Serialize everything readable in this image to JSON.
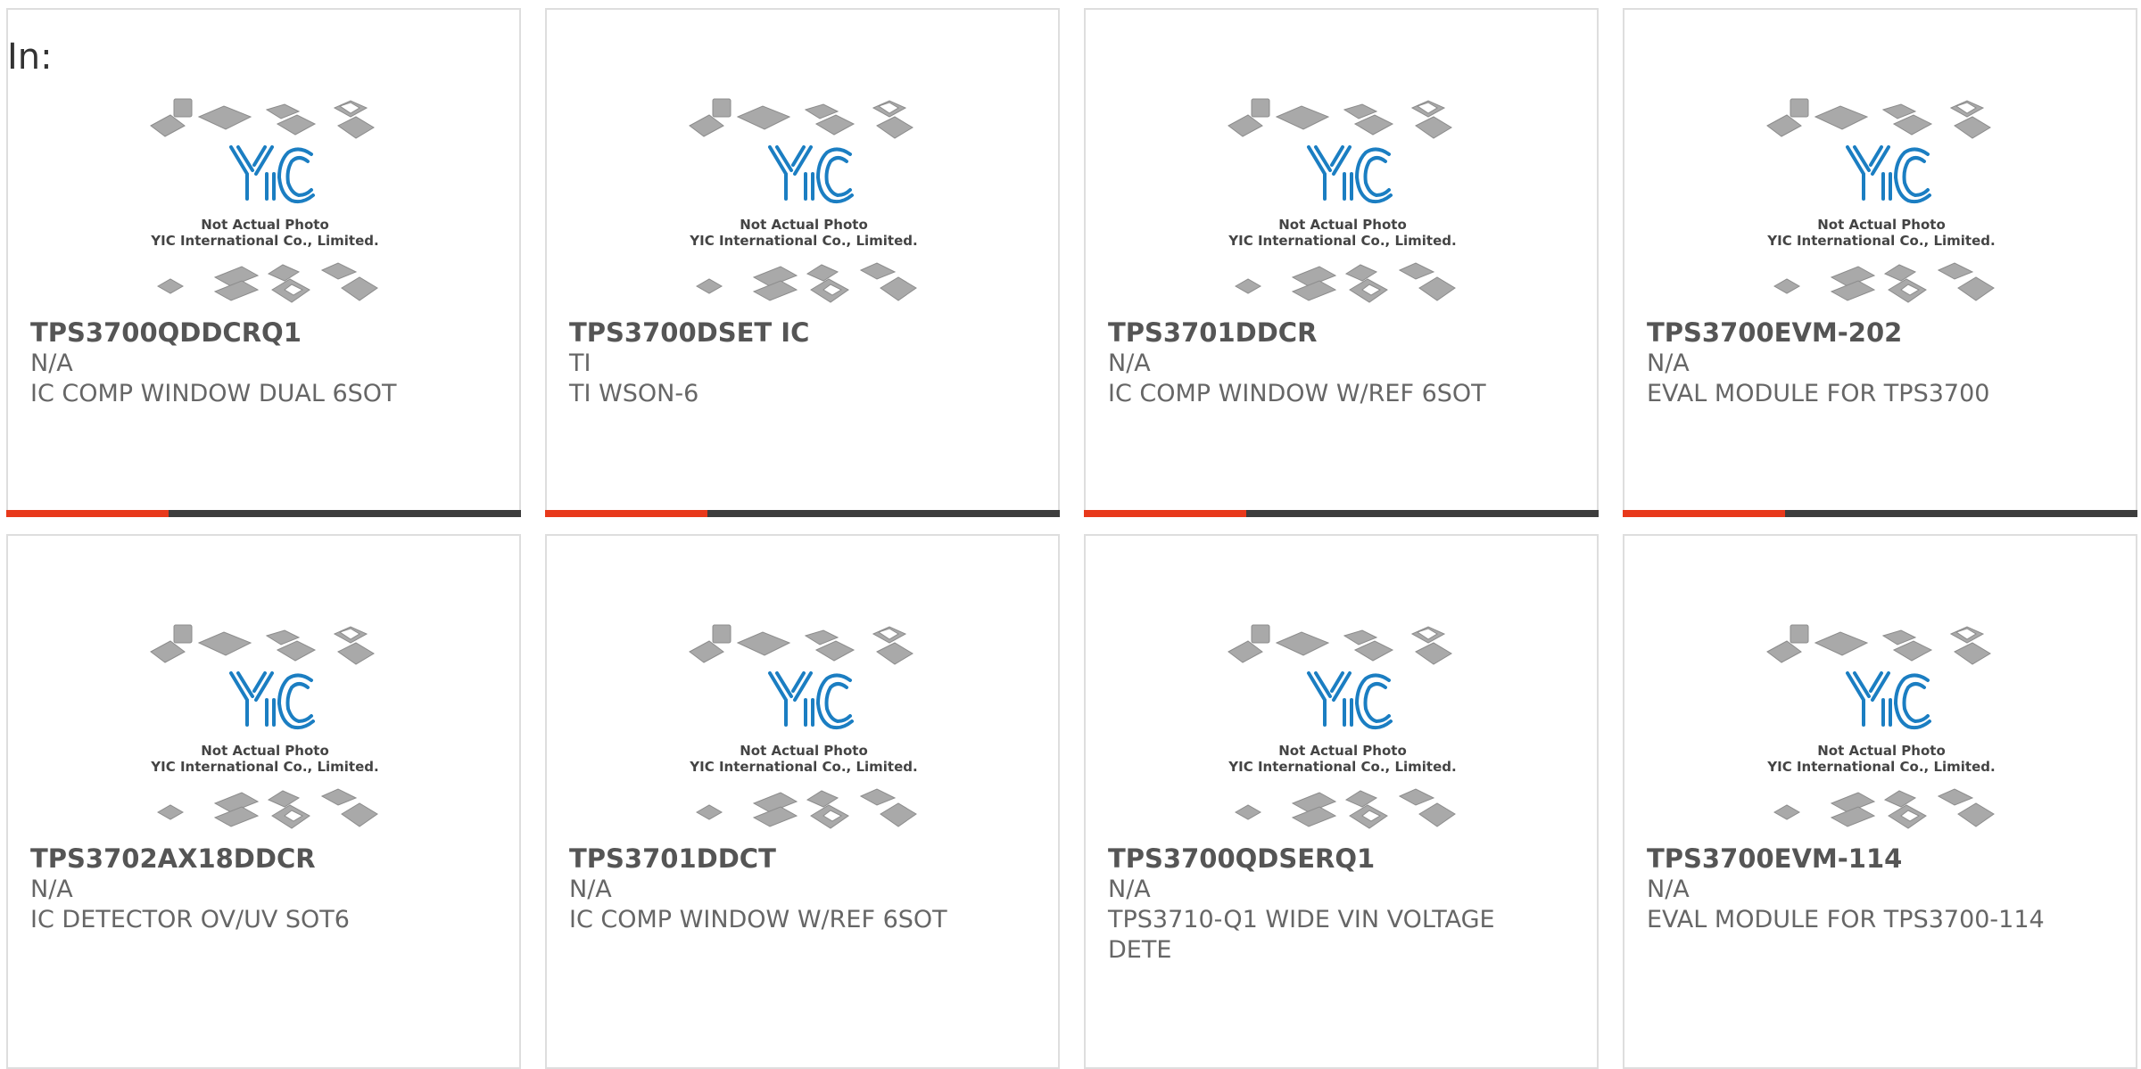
{
  "page": {
    "filter_label": "In:"
  },
  "theme": {
    "accent_color": "#e8391b",
    "bar_color": "#3d3d3d"
  },
  "placeholder": {
    "caption_line1": "Not Actual Photo",
    "caption_line2": "YIC International Co., Limited.",
    "logo_text": "YIC"
  },
  "products": [
    {
      "part_number": "TPS3700QDDCRQ1",
      "brand": "N/A",
      "description": "IC COMP WINDOW DUAL 6SOT"
    },
    {
      "part_number": "TPS3700DSET IC",
      "brand": "TI",
      "description": "TI WSON-6"
    },
    {
      "part_number": "TPS3701DDCR",
      "brand": "N/A",
      "description": "IC COMP WINDOW W/REF 6SOT"
    },
    {
      "part_number": "TPS3700EVM-202",
      "brand": "N/A",
      "description": "EVAL MODULE FOR TPS3700"
    },
    {
      "part_number": "TPS3702AX18DDCR",
      "brand": "N/A",
      "description": "IC DETECTOR OV/UV SOT6"
    },
    {
      "part_number": "TPS3701DDCT",
      "brand": "N/A",
      "description": "IC COMP WINDOW W/REF 6SOT"
    },
    {
      "part_number": "TPS3700QDSERQ1",
      "brand": "N/A",
      "description": "TPS3710-Q1 WIDE VIN VOLTAGE DETE"
    },
    {
      "part_number": "TPS3700EVM-114",
      "brand": "N/A",
      "description": "EVAL MODULE FOR TPS3700-114"
    }
  ]
}
